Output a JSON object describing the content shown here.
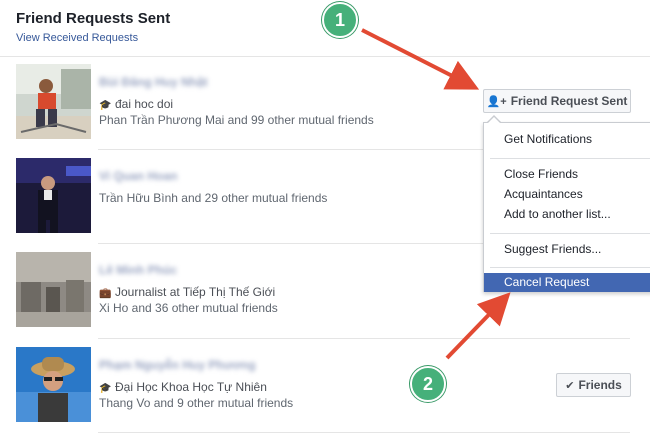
{
  "header": {
    "title": "Friend Requests Sent",
    "view_received": "View Received Requests"
  },
  "rows": [
    {
      "name": "Bùi Đăng Huy Nhật",
      "meta_icon": "school-icon",
      "meta": "đai hoc doi",
      "mutual": "Phan Trần Phương Mai and 99 other mutual friends"
    },
    {
      "name": "Vi Quan Hoan",
      "mutual": "Trần Hữu Bình and 29 other mutual friends"
    },
    {
      "name": "Lê Minh Phúc",
      "meta_icon": "briefcase-icon",
      "meta": "Journalist at Tiếp Thị Thế Giới",
      "mutual": "Xi Ho and 36 other mutual friends"
    },
    {
      "name": "Phạm Nguyễn Huy Phương",
      "meta_icon": "school-icon",
      "meta": "Đại Học Khoa Học Tự Nhiên",
      "mutual": "Thang Vo and 9 other mutual friends"
    }
  ],
  "buttons": {
    "friend_request_sent": "Friend Request Sent",
    "friends": "Friends"
  },
  "menu": {
    "items": [
      "Get Notifications",
      "Close Friends",
      "Acquaintances",
      "Add to another list...",
      "Suggest Friends...",
      "Cancel Request"
    ],
    "active": "Cancel Request"
  },
  "annotations": {
    "step1": "1",
    "step2": "2",
    "arrow_color": "#e24a33",
    "badge_color": "#46b07a"
  },
  "colors": {
    "link": "#365899",
    "menu_highlight": "#4267b2"
  }
}
